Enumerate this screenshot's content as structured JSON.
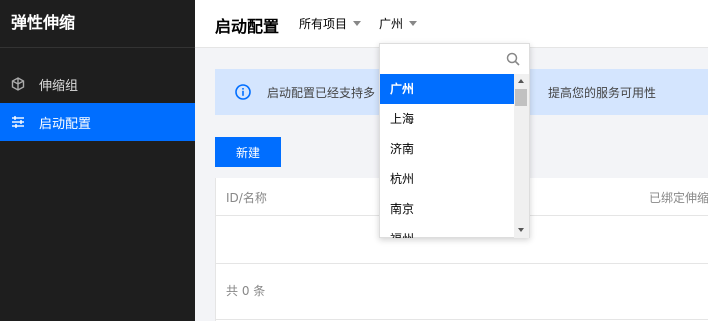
{
  "sidebar": {
    "title": "弹性伸缩",
    "items": [
      {
        "label": "伸缩组",
        "icon": "cube-icon"
      },
      {
        "label": "启动配置",
        "icon": "sliders-icon",
        "active": true
      }
    ]
  },
  "header": {
    "title": "启动配置",
    "project_select": "所有项目",
    "region_select": "广州"
  },
  "info": {
    "text_left": "启动配置已经支持多",
    "text_right": "提高您的服务可用性"
  },
  "toolbar": {
    "new_label": "新建"
  },
  "table": {
    "columns": [
      "ID/名称",
      "已绑定伸缩"
    ],
    "total_text": "共 0 条"
  },
  "dropdown": {
    "search_placeholder": "",
    "options": [
      "广州",
      "上海",
      "济南",
      "杭州",
      "南京",
      "福州"
    ],
    "selected": "广州"
  },
  "colors": {
    "accent": "#006eff",
    "sidebar_bg": "#1e1e1e",
    "info_bg": "#d4e5fe"
  }
}
